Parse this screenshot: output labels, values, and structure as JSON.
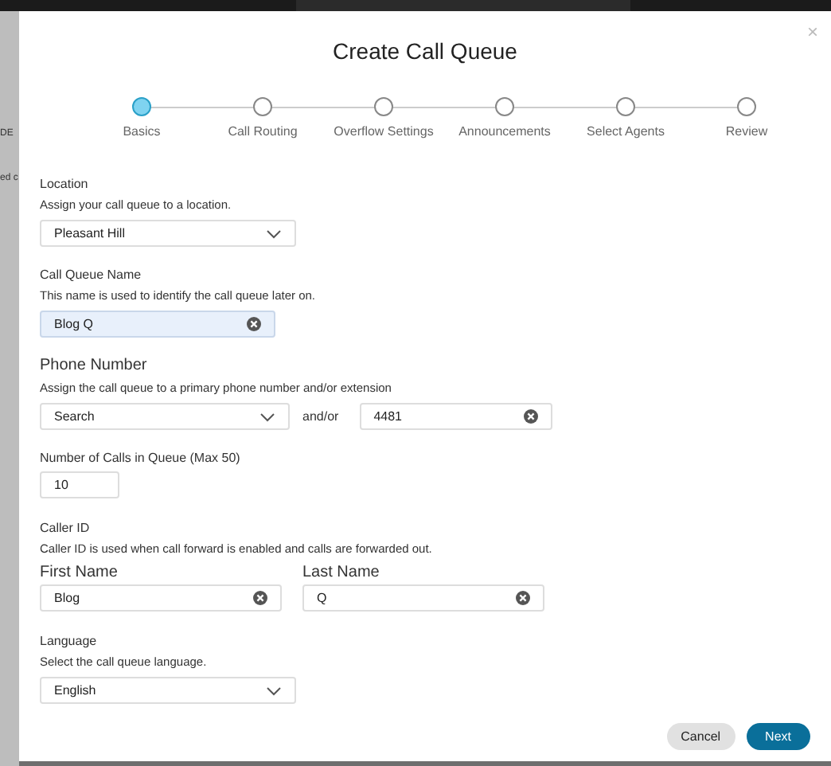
{
  "background": {
    "fragments": [
      "DE",
      "ed c"
    ]
  },
  "dialog": {
    "title": "Create Call Queue",
    "close": "×"
  },
  "steps": [
    {
      "label": "Basics",
      "selected": true
    },
    {
      "label": "Call Routing",
      "selected": false
    },
    {
      "label": "Overflow Settings",
      "selected": false
    },
    {
      "label": "Announcements",
      "selected": false
    },
    {
      "label": "Select Agents",
      "selected": false
    },
    {
      "label": "Review",
      "selected": false
    }
  ],
  "location": {
    "label": "Location",
    "hint": "Assign your call queue to a location.",
    "value": "Pleasant Hill"
  },
  "queue_name": {
    "label": "Call Queue Name",
    "hint": "This name is used to identify the call queue later on.",
    "value": "Blog Q",
    "focused": true
  },
  "phone_number": {
    "label": "Phone Number",
    "hint": "Assign the call queue to a primary phone number and/or extension",
    "number": "Search",
    "joiner": "and/or",
    "extension": "4481"
  },
  "calls_in_queue": {
    "label": "Number of Calls in Queue (Max 50)",
    "value": "10"
  },
  "caller_id": {
    "label": "Caller ID",
    "hint": "Caller ID is used when call forward is enabled and calls are forwarded out.",
    "first_name_label": "First Name",
    "first_name": "Blog",
    "last_name_label": "Last Name",
    "last_name": "Q"
  },
  "language": {
    "label": "Language",
    "hint": "Select the call queue language.",
    "value": "English"
  },
  "buttons": [
    {
      "label": "Cancel",
      "kind": "secondary"
    },
    {
      "label": "Next",
      "kind": "primary"
    }
  ]
}
